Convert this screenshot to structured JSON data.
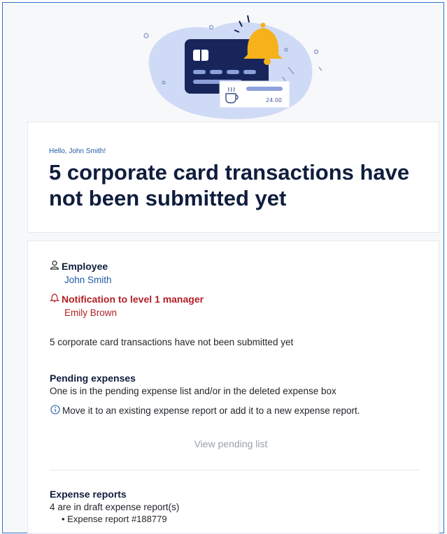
{
  "header": {
    "greeting": "Hello, John Smith!",
    "title": "5 corporate card transactions have not been submitted yet"
  },
  "illustration": {
    "amount": "24.00",
    "icons": [
      "credit-card-icon",
      "bell-icon",
      "coffee-cup-icon"
    ]
  },
  "people": {
    "employee_label": "Employee",
    "employee_name": "John Smith",
    "manager_notice_label": "Notification to level 1 manager",
    "manager_name": "Emily Brown"
  },
  "summary_text": "5 corporate card transactions have not been submitted yet",
  "pending": {
    "title": "Pending expenses",
    "description": "One is in the pending expense list and/or in the deleted expense box",
    "info": "Move it to an existing expense report or add it to a new expense report.",
    "button_label": "View pending list"
  },
  "reports": {
    "title": "Expense reports",
    "description": "4 are in draft expense report(s)",
    "items": [
      "• Expense report #188779"
    ]
  },
  "colors": {
    "accent_blue": "#1f5aa6",
    "alert_red": "#b22025",
    "title_navy": "#0f1d3d",
    "muted_gray": "#9aa0a6"
  }
}
